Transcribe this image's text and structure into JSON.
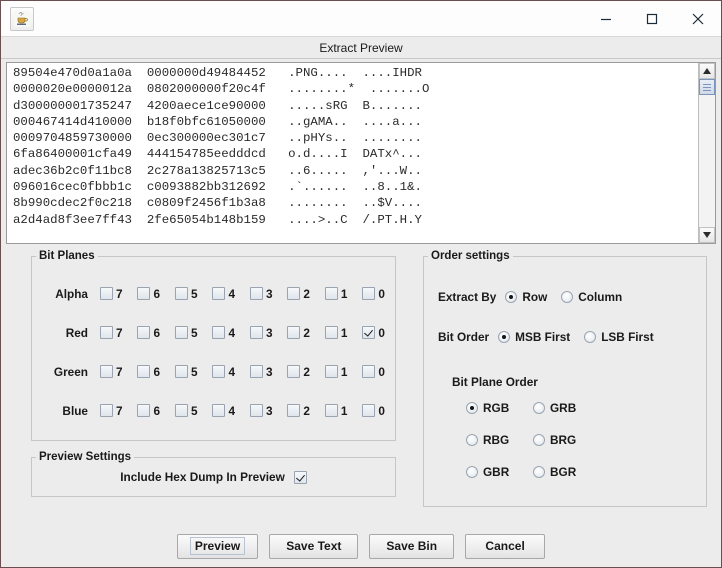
{
  "window": {
    "app_icon": "java-coffee-cup-icon",
    "subtitle": "Extract Preview",
    "controls": {
      "minimize": "minimize-icon",
      "maximize": "maximize-icon",
      "close": "close-icon"
    }
  },
  "hex_preview": {
    "lines": [
      "89504e470d0a1a0a  0000000d49484452   .PNG....  ....IHDR",
      "0000020e0000012a  0802000000f20c4f   ........*  .......O",
      "d300000001735247  4200aece1ce90000   .....sRG  B.......",
      "000467414d410000  b18f0bfc61050000   ..gAMA..  ....a...",
      "0009704859730000  0ec300000ec301c7   ..pHYs..  ........",
      "6fa86400001cfa49  444154785eedddcd   o.d....I  DATx^...",
      "adec36b2c0f11bc8  2c278a13825713c5   ..6.....  ,'...W..",
      "096016cec0fbbb1c  c0093882bb312692   .`......  ..8..1&.",
      "8b990cdec2f0c218  c0809f2456f1b3a8   ........  ..$V....",
      "a2d4ad8f3ee7ff43  2fe65054b148b159   ....>..C  /.PT.H.Y"
    ],
    "scrollbar": {
      "up_arrow": "scroll-up-arrow-icon",
      "down_arrow": "scroll-down-arrow-icon"
    }
  },
  "bit_planes": {
    "legend": "Bit Planes",
    "bit_labels": [
      "7",
      "6",
      "5",
      "4",
      "3",
      "2",
      "1",
      "0"
    ],
    "channels": [
      {
        "name": "Alpha",
        "checked": [
          false,
          false,
          false,
          false,
          false,
          false,
          false,
          false
        ]
      },
      {
        "name": "Red",
        "checked": [
          false,
          false,
          false,
          false,
          false,
          false,
          false,
          true
        ]
      },
      {
        "name": "Green",
        "checked": [
          false,
          false,
          false,
          false,
          false,
          false,
          false,
          false
        ]
      },
      {
        "name": "Blue",
        "checked": [
          false,
          false,
          false,
          false,
          false,
          false,
          false,
          false
        ]
      }
    ]
  },
  "preview_settings": {
    "legend": "Preview Settings",
    "include_hex_dump_label": "Include Hex Dump In Preview",
    "include_hex_dump_checked": true
  },
  "order_settings": {
    "legend": "Order settings",
    "extract_by": {
      "label": "Extract By",
      "options": [
        "Row",
        "Column"
      ],
      "selected": "Row"
    },
    "bit_order": {
      "label": "Bit Order",
      "options": [
        "MSB First",
        "LSB First"
      ],
      "selected": "MSB First"
    },
    "bit_plane_order": {
      "label": "Bit Plane Order",
      "options": [
        "RGB",
        "GRB",
        "RBG",
        "BRG",
        "GBR",
        "BGR"
      ],
      "selected": "RGB"
    }
  },
  "footer": {
    "buttons": [
      {
        "label": "Preview",
        "focused": true
      },
      {
        "label": "Save Text",
        "focused": false
      },
      {
        "label": "Save Bin",
        "focused": false
      },
      {
        "label": "Cancel",
        "focused": false
      }
    ]
  },
  "colors": {
    "panel_background": "#ececec",
    "text_area_background": "#ffffff",
    "border": "#c6c6c6",
    "accent": "#7a94bb"
  }
}
